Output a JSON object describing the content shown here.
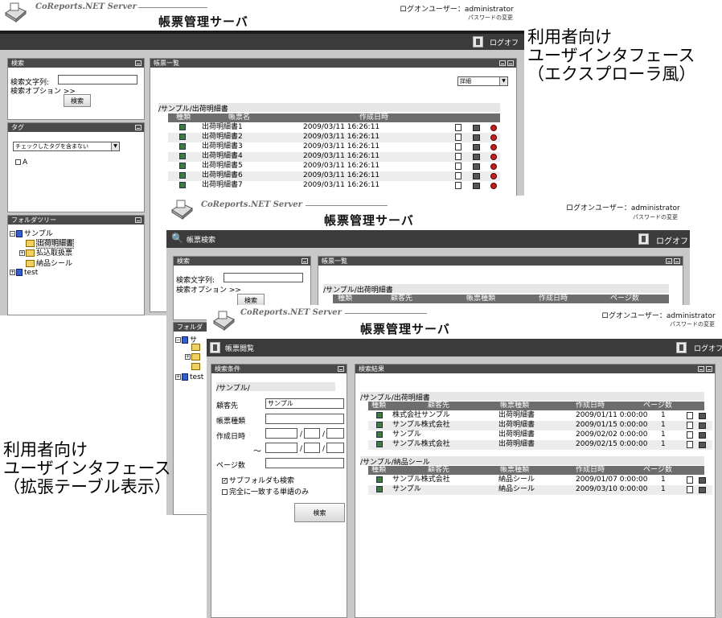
{
  "captions": {
    "explorer": [
      "利用者向け",
      "ユーザインタフェース",
      "（エクスプローラ風）"
    ],
    "table": [
      "利用者向け",
      "ユーザインタフェース",
      "（拡張テーブル表示）"
    ]
  },
  "common": {
    "logo": "CoReports.NET Server",
    "app_title": "帳票管理サーバ",
    "logon": "ログオンユーザー：administrator",
    "password_change": "パスワードの変更",
    "logoff": "ログオフ"
  },
  "win1": {
    "search_panel": {
      "title": "検索",
      "label": "検索文字列:",
      "options": "検索オプション >>",
      "button": "検索"
    },
    "tag_panel": {
      "title": "タグ",
      "select": "チェックしたタグを含まない",
      "tag_a": "A"
    },
    "folder_panel": {
      "title": "フォルダツリー",
      "root": "サンプル",
      "children": [
        "出荷明細書",
        "払込取扱票",
        "納品シール"
      ],
      "other": "test"
    },
    "list_panel": {
      "title": "帳票一覧",
      "view_select": "詳細",
      "path": "/サンプル/出荷明細書",
      "headers": [
        "種類",
        "帳票名",
        "作成日時"
      ],
      "rows": [
        {
          "name": "出荷明細書1",
          "date": "2009/03/11 16:26:11"
        },
        {
          "name": "出荷明細書2",
          "date": "2009/03/11 16:26:11"
        },
        {
          "name": "出荷明細書3",
          "date": "2009/03/11 16:26:11"
        },
        {
          "name": "出荷明細書4",
          "date": "2009/03/11 16:26:11"
        },
        {
          "name": "出荷明細書5",
          "date": "2009/03/11 16:26:11"
        },
        {
          "name": "出荷明細書6",
          "date": "2009/03/11 16:26:11"
        },
        {
          "name": "出荷明細書7",
          "date": "2009/03/11 16:26:11"
        }
      ]
    }
  },
  "win2": {
    "bar_label": "帳票検索",
    "search_panel": {
      "title": "検索",
      "label": "検索文字列:",
      "options": "検索オプション >>",
      "button": "検索"
    },
    "folder_panel": {
      "title": "フォルダ",
      "root_short": "サ",
      "other": "test"
    },
    "list_panel": {
      "title": "帳票一覧",
      "path": "/サンプル/出荷明細書",
      "headers": [
        "種類",
        "顧客先",
        "帳票種類",
        "作成日時",
        "ページ数"
      ]
    }
  },
  "win3": {
    "bar_label": "帳票閲覧",
    "logoff_short": "ログオフ",
    "cond_panel": {
      "title": "検索条件",
      "path": "/サンプル/",
      "customer_label": "顧客先",
      "customer_value": "サンプル",
      "type_label": "帳票種類",
      "date_label": "作成日時",
      "range_sep": "〜",
      "slash": "/",
      "pages_label": "ページ数",
      "subfolder": "サブフォルダも検索",
      "exact": "完全に一致する単語のみ",
      "button": "検索"
    },
    "result_panel": {
      "title": "検索結果",
      "groups": [
        {
          "path": "/サンプル/出荷明細書",
          "headers": [
            "種類",
            "顧客先",
            "帳票種類",
            "作成日時",
            "ページ数"
          ],
          "rows": [
            {
              "customer": "株式会社サンプル",
              "type": "出荷明細書",
              "date": "2009/01/11 0:00:00",
              "pages": "1"
            },
            {
              "customer": "サンプル株式会社",
              "type": "出荷明細書",
              "date": "2009/01/15 0:00:00",
              "pages": "1"
            },
            {
              "customer": "サンプル",
              "type": "出荷明細書",
              "date": "2009/02/02 0:00:00",
              "pages": "1"
            },
            {
              "customer": "サンプル株式会社",
              "type": "出荷明細書",
              "date": "2009/02/15 0:00:00",
              "pages": "1"
            }
          ]
        },
        {
          "path": "/サンプル/納品シール",
          "headers": [
            "種類",
            "顧客先",
            "帳票種類",
            "作成日時",
            "ページ数"
          ],
          "rows": [
            {
              "customer": "サンプル株式会社",
              "type": "納品シール",
              "date": "2009/01/07 0:00:00",
              "pages": "1"
            },
            {
              "customer": "サンプル",
              "type": "納品シール",
              "date": "2009/03/10 0:00:00",
              "pages": "1"
            }
          ]
        }
      ]
    }
  }
}
